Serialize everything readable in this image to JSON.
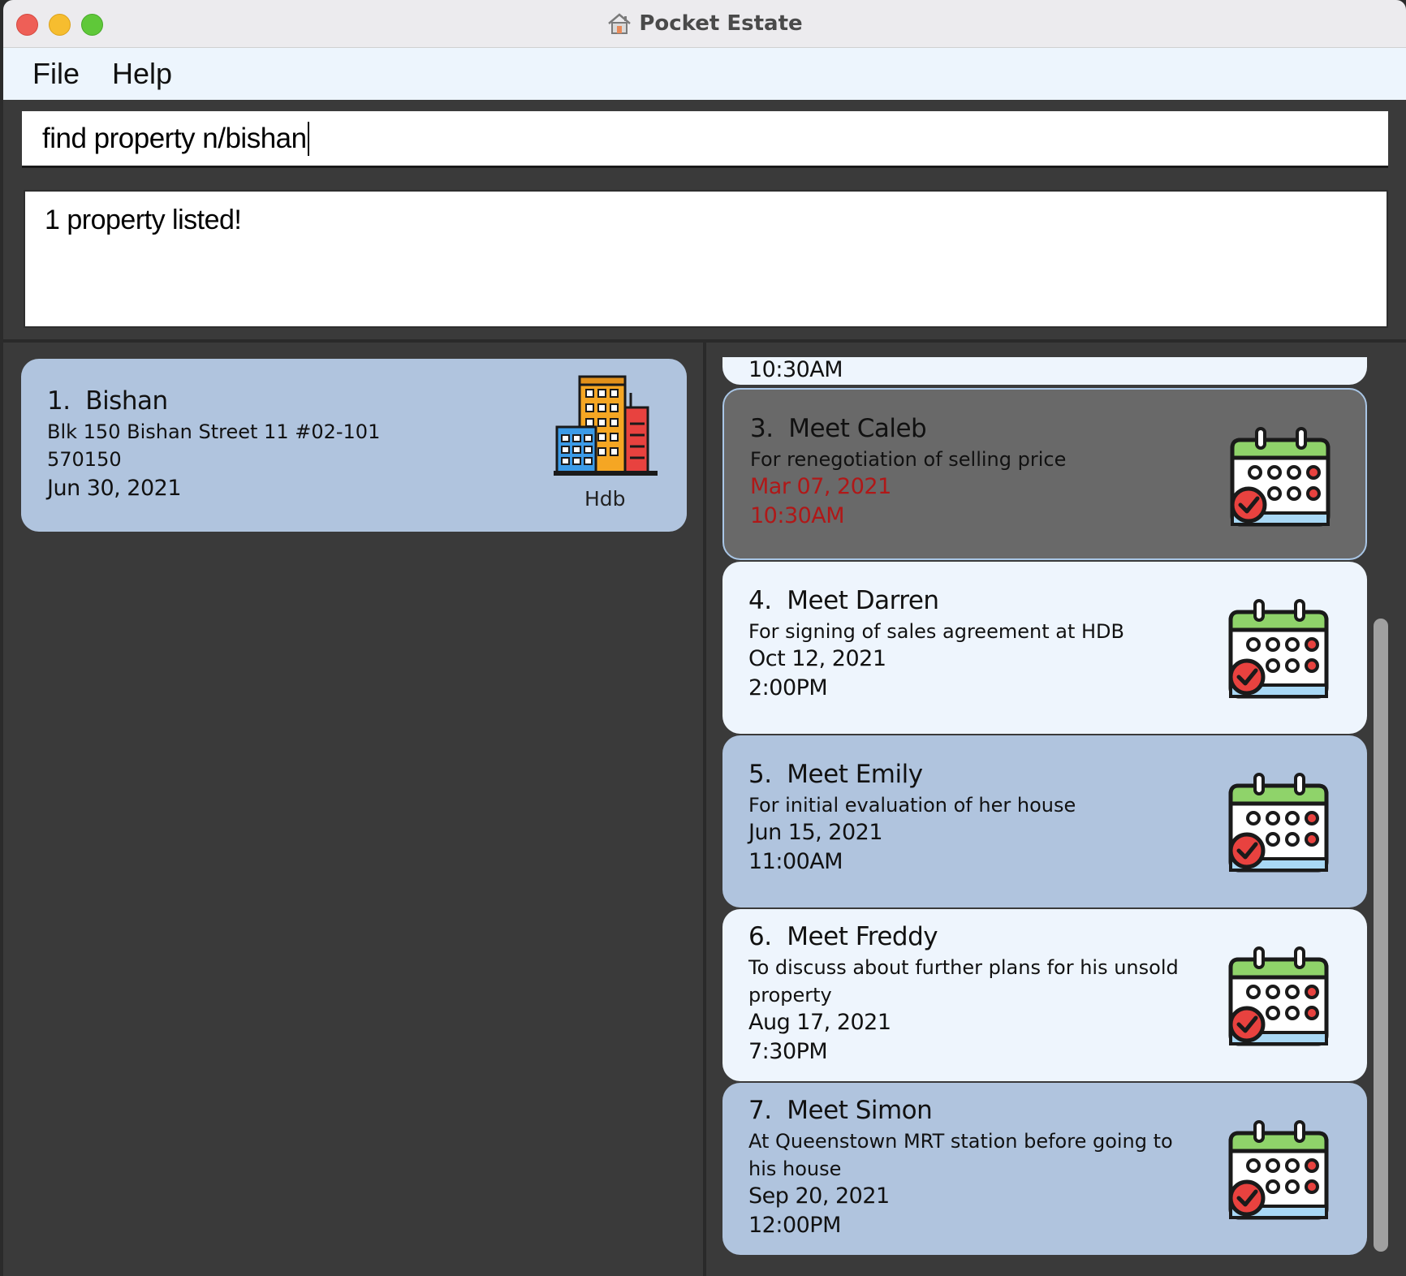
{
  "window": {
    "title": "Pocket Estate"
  },
  "menu": {
    "file": "File",
    "help": "Help"
  },
  "command": {
    "value": "find property n/bishan"
  },
  "result": {
    "message": "1 property listed!"
  },
  "properties": [
    {
      "index": "1.",
      "name": "Bishan",
      "address": "Blk 150 Bishan Street 11 #02-101",
      "postal": "570150",
      "deadline": "Jun 30, 2021",
      "type": "Hdb"
    }
  ],
  "appointments": {
    "partial_time": "10:30AM",
    "items": [
      {
        "index": "3.",
        "name": "Meet Caleb",
        "remark": "For renegotiation of selling price",
        "date": "Mar 07, 2021",
        "time": "10:30AM"
      },
      {
        "index": "4.",
        "name": "Meet Darren",
        "remark": "For signing of sales agreement at HDB",
        "date": "Oct 12, 2021",
        "time": "2:00PM"
      },
      {
        "index": "5.",
        "name": "Meet Emily",
        "remark": "For initial evaluation of her house",
        "date": "Jun 15, 2021",
        "time": "11:00AM"
      },
      {
        "index": "6.",
        "name": "Meet Freddy",
        "remark_line1": "To discuss about further plans for his unsold",
        "remark_line2": "property",
        "date": "Aug 17, 2021",
        "time": "7:30PM"
      },
      {
        "index": "7.",
        "name": "Meet Simon",
        "remark_line1": "At Queenstown MRT station before going to",
        "remark_line2": "his house",
        "date": "Sep 20, 2021",
        "time": "12:00PM"
      }
    ]
  },
  "colors": {
    "card_blue": "#b0c4de",
    "card_light": "#eef5fd",
    "card_selected": "#696969",
    "overdue_red": "#b01818"
  },
  "icons": {
    "property_type": "building-icon",
    "appointment": "calendar-check-icon"
  }
}
